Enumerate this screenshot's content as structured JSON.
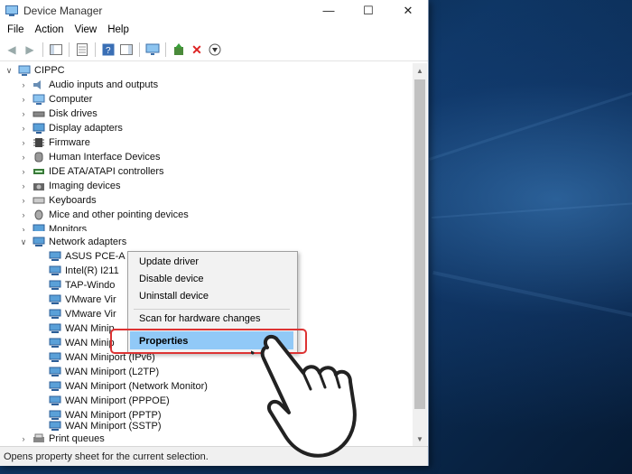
{
  "window": {
    "title": "Device Manager"
  },
  "window_buttons": {
    "minimize": "—",
    "maximize": "☐",
    "close": "✕"
  },
  "menubar": [
    "File",
    "Action",
    "View",
    "Help"
  ],
  "tree": {
    "root": "CIPPC",
    "categories": [
      "Audio inputs and outputs",
      "Computer",
      "Disk drives",
      "Display adapters",
      "Firmware",
      "Human Interface Devices",
      "IDE ATA/ATAPI controllers",
      "Imaging devices",
      "Keyboards",
      "Mice and other pointing devices",
      "Monitors"
    ],
    "network": {
      "label": "Network adapters",
      "children": [
        "ASUS PCE-A",
        "Intel(R) I211",
        "TAP-Windo",
        "VMware Vir",
        "VMware Vir",
        "WAN Minip",
        "WAN Minip",
        "WAN Miniport (IPv6)",
        "WAN Miniport (L2TP)",
        "WAN Miniport (Network Monitor)",
        "WAN Miniport (PPPOE)",
        "WAN Miniport (PPTP)",
        "WAN Miniport (SSTP)"
      ]
    },
    "after": "Print queues"
  },
  "context_menu": {
    "items": [
      "Update driver",
      "Disable device",
      "Uninstall device"
    ],
    "scan": "Scan for hardware changes",
    "properties": "Properties"
  },
  "statusbar": {
    "text": "Opens property sheet for the current selection."
  },
  "colors": {
    "selection": "#91c9f7",
    "annotation": "#dd3333",
    "desktop": "#0d3461"
  }
}
